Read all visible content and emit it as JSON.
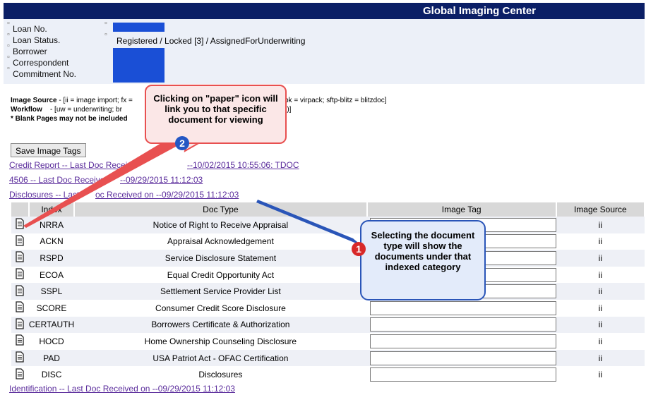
{
  "header": {
    "title": "Global Imaging Center"
  },
  "loan_info": {
    "labels": [
      "Loan No.",
      "Loan Status.",
      "Borrower",
      "Correspondent",
      "Commitment No."
    ],
    "loan_status_value": "Registered / Locked [3] / AssignedForUnderwriting"
  },
  "legend": {
    "image_source_label": "Image Source",
    "image_source_text": "- [ii = image import; fx =",
    "image_source_tail": "vpk = virpack; sftp-blitz = blitzdoc]",
    "workflow_label": "Workflow",
    "workflow_text": "- [uw = underwriting; br",
    "workflow_tail": "ssions)]",
    "note": "* Blank Pages may not be included"
  },
  "actions": {
    "save_label": "Save Image Tags"
  },
  "doc_links": [
    "Credit Report -- Last Doc Recei",
    "--10/02/2015 10:55:06: TDOC",
    "4506 -- Last Doc Receive",
    "--09/29/2015 11:12:03",
    "Disclosures -- Last",
    "oc Received on --09/29/2015 11:12:03",
    "Identification -- Last Doc Received on --09/29/2015 11:12:03"
  ],
  "table": {
    "headers": [
      "",
      "Index",
      "Doc Type",
      "Image Tag",
      "Image Source"
    ],
    "rows": [
      {
        "index": "NRRA",
        "doc_type": "Notice of Right to Receive Appraisal",
        "source": "ii"
      },
      {
        "index": "ACKN",
        "doc_type": "Appraisal Acknowledgement",
        "source": "ii"
      },
      {
        "index": "RSPD",
        "doc_type": "Service Disclosure Statement",
        "source": "ii"
      },
      {
        "index": "ECOA",
        "doc_type": "Equal Credit Opportunity Act",
        "source": "ii"
      },
      {
        "index": "SSPL",
        "doc_type": "Settlement Service Provider List",
        "source": "ii"
      },
      {
        "index": "SCORE",
        "doc_type": "Consumer Credit Score Disclosure",
        "source": "ii"
      },
      {
        "index": "CERTAUTH",
        "doc_type": "Borrowers Certificate & Authorization",
        "source": "ii"
      },
      {
        "index": "HOCD",
        "doc_type": "Home Ownership Counseling Disclosure",
        "source": "ii"
      },
      {
        "index": "PAD",
        "doc_type": "USA Patriot Act - OFAC Certification",
        "source": "ii"
      },
      {
        "index": "DISC",
        "doc_type": "Disclosures",
        "source": "ii"
      }
    ]
  },
  "callouts": {
    "paper_icon": "Clicking on \"paper\" icon will link you to that specific document for viewing",
    "doc_type": "Selecting the document type will show the documents under that indexed category",
    "num1": "1",
    "num2": "2"
  },
  "icons": {
    "document": "document-icon"
  },
  "colors": {
    "header_bg": "#0b1f66",
    "redacted": "#1a4fd6",
    "link": "#5b2d9c",
    "callout_red": "#e85050",
    "callout_blue": "#2a55b8"
  }
}
